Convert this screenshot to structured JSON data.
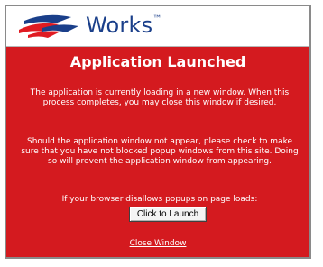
{
  "logo": {
    "brand_text": "Works",
    "trademark": "™",
    "icon": "bank-flag-logo-icon"
  },
  "dialog": {
    "title": "Application Launched",
    "paragraph_1": "The application is currently loading in a new window. When this process completes, you may close this window if desired.",
    "paragraph_2": "Should the application window not appear, please check to make sure that you have not blocked popup windows from this site. Doing so will prevent the application window from appearing.",
    "paragraph_3": "If your browser disallows popups on page loads:",
    "launch_button": "Click to Launch",
    "close_link": "Close Window"
  },
  "colors": {
    "panel_background": "#d41a1f",
    "logo_text": "#1a3f8a",
    "text": "#ffffff"
  }
}
